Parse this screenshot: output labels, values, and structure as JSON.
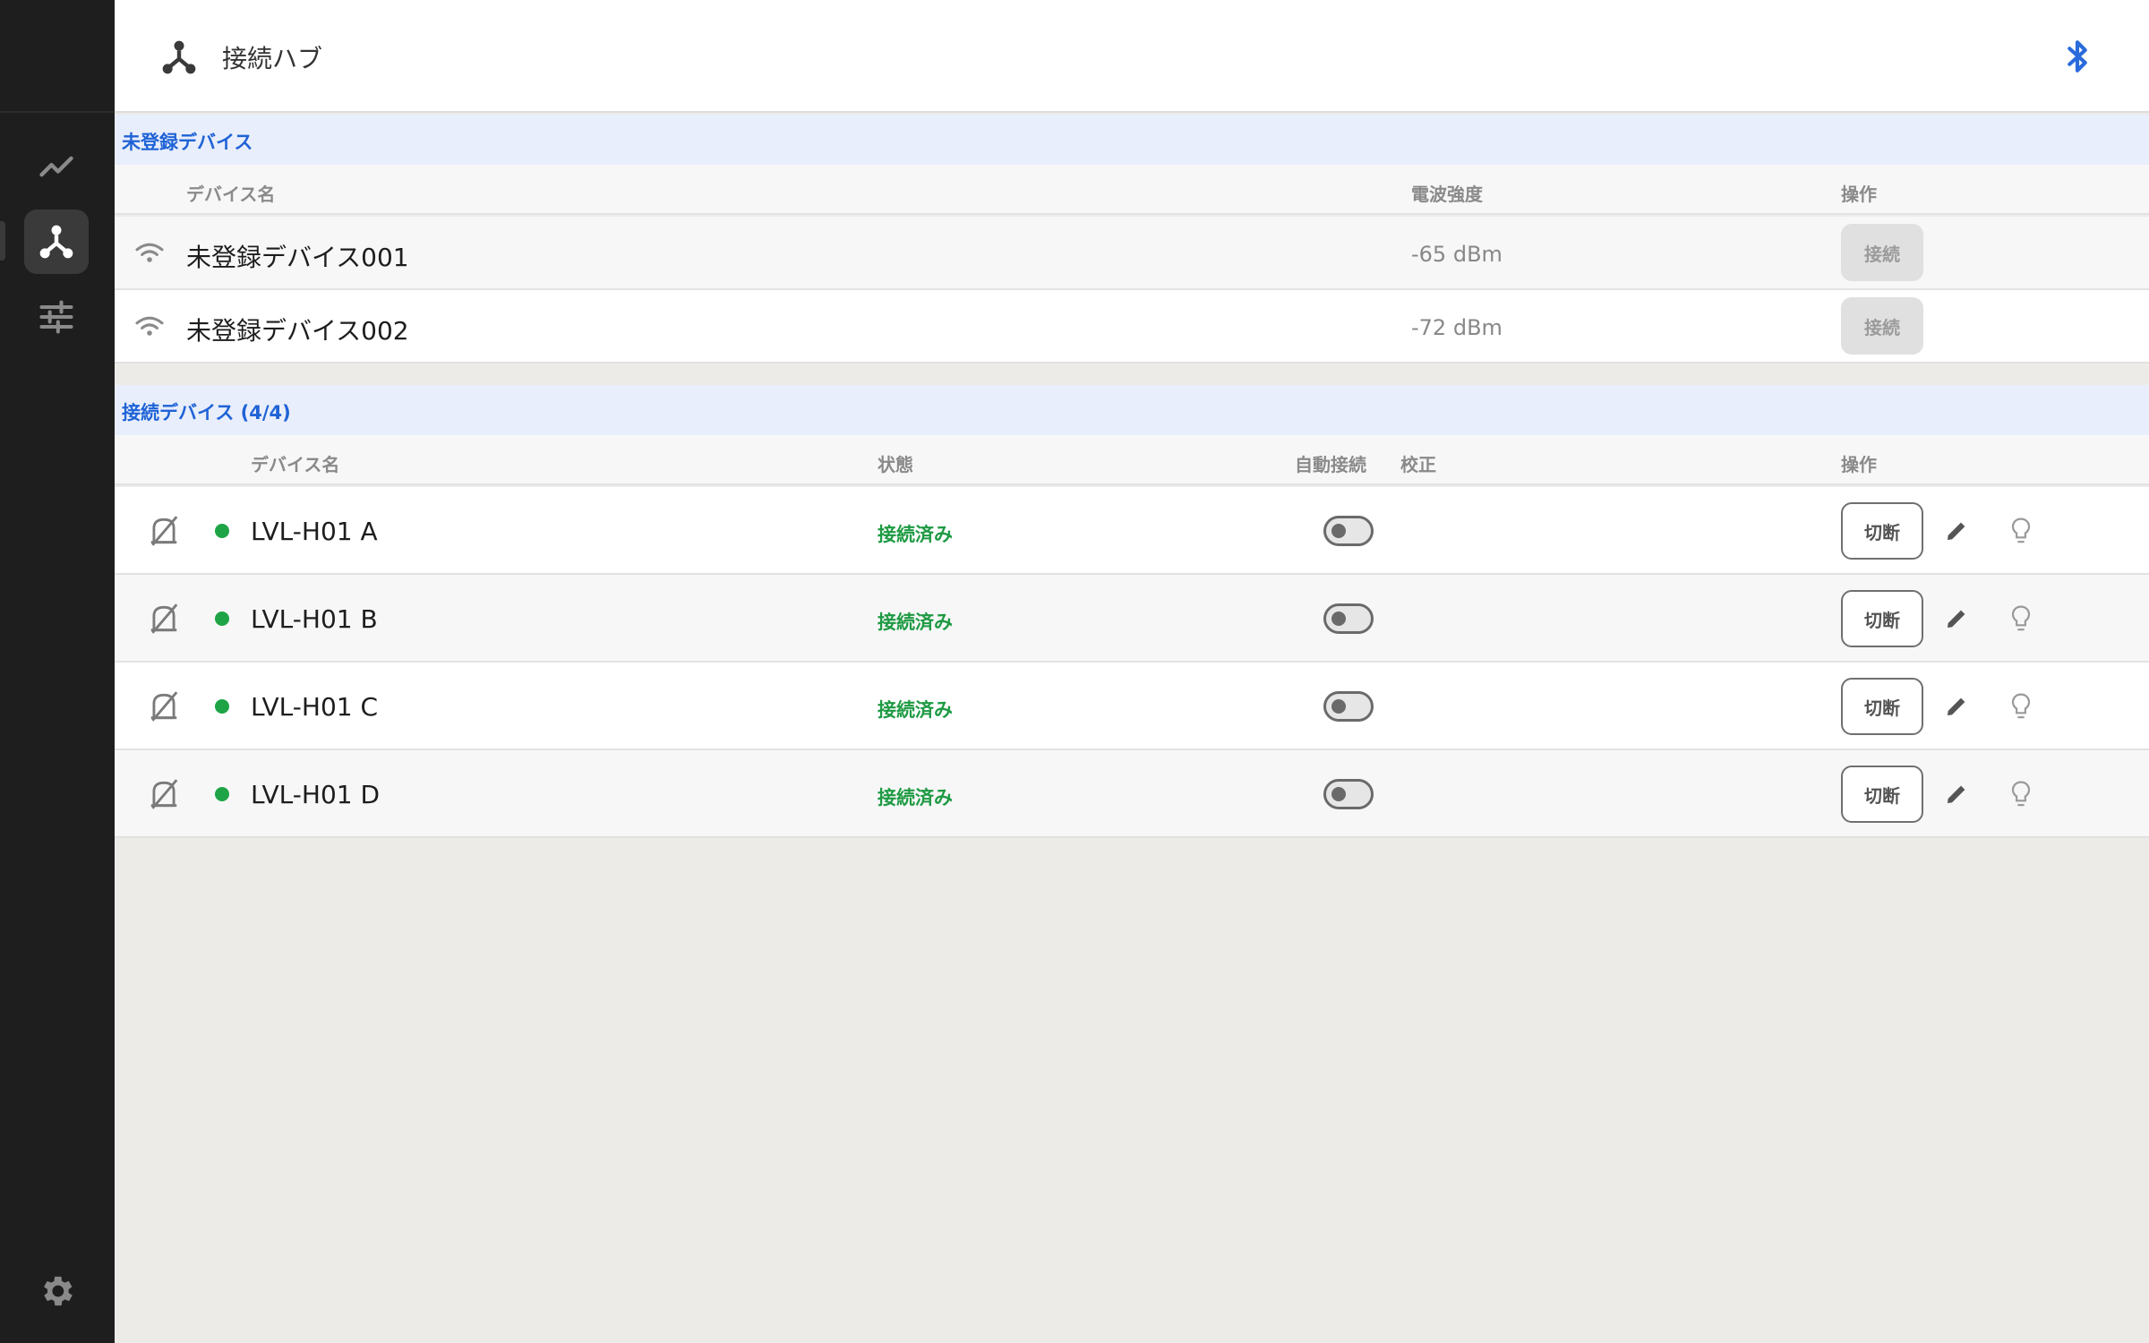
{
  "header": {
    "title": "接続ハブ"
  },
  "unregistered": {
    "title": "未登録デバイス",
    "columns": {
      "name": "デバイス名",
      "signal": "電波強度",
      "action": "操作"
    },
    "rows": [
      {
        "name": "未登録デバイス001",
        "signal": "-65 dBm",
        "action": "接続"
      },
      {
        "name": "未登録デバイス002",
        "signal": "-72 dBm",
        "action": "接続"
      }
    ]
  },
  "connected": {
    "title": "接続デバイス (4/4)",
    "columns": {
      "name": "デバイス名",
      "status": "状態",
      "auto": "自動接続",
      "calib": "校正",
      "action": "操作"
    },
    "rows": [
      {
        "name": "LVL-H01 A",
        "status": "接続済み",
        "auto_connect": false,
        "action": "切断"
      },
      {
        "name": "LVL-H01 B",
        "status": "接続済み",
        "auto_connect": false,
        "action": "切断"
      },
      {
        "name": "LVL-H01 C",
        "status": "接続済み",
        "auto_connect": false,
        "action": "切断"
      },
      {
        "name": "LVL-H01 D",
        "status": "接続済み",
        "auto_connect": false,
        "action": "切断"
      }
    ]
  },
  "sidebar": {
    "items": [
      {
        "icon": "trend-chart-icon",
        "active": false
      },
      {
        "icon": "hub-icon",
        "active": true
      },
      {
        "icon": "sliders-icon",
        "active": false
      },
      {
        "icon": "gear-icon",
        "active": false
      }
    ]
  },
  "colors": {
    "accent": "#1f63d6",
    "success": "#1ea446",
    "sidebar": "#1e1e1e",
    "bluetooth": "#2a6bdc"
  }
}
